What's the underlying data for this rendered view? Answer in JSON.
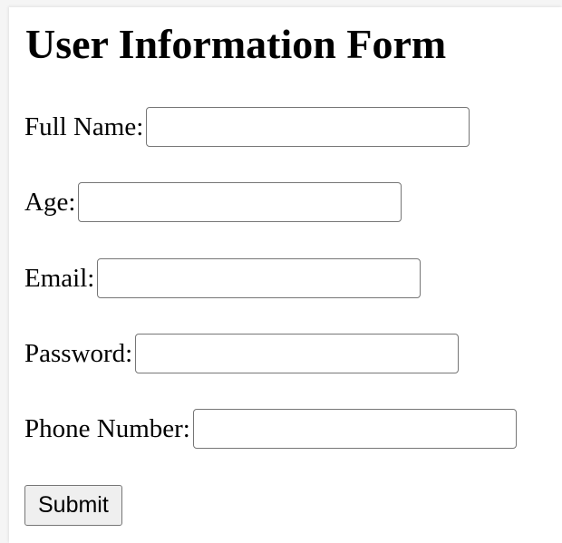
{
  "form": {
    "title": "User Information Form",
    "fields": [
      {
        "label": "Full Name:",
        "value": "",
        "placeholder": ""
      },
      {
        "label": "Age:",
        "value": "",
        "placeholder": ""
      },
      {
        "label": "Email:",
        "value": "",
        "placeholder": ""
      },
      {
        "label": "Password:",
        "value": "",
        "placeholder": ""
      },
      {
        "label": "Phone Number:",
        "value": "",
        "placeholder": ""
      }
    ],
    "submit_label": "Submit"
  }
}
